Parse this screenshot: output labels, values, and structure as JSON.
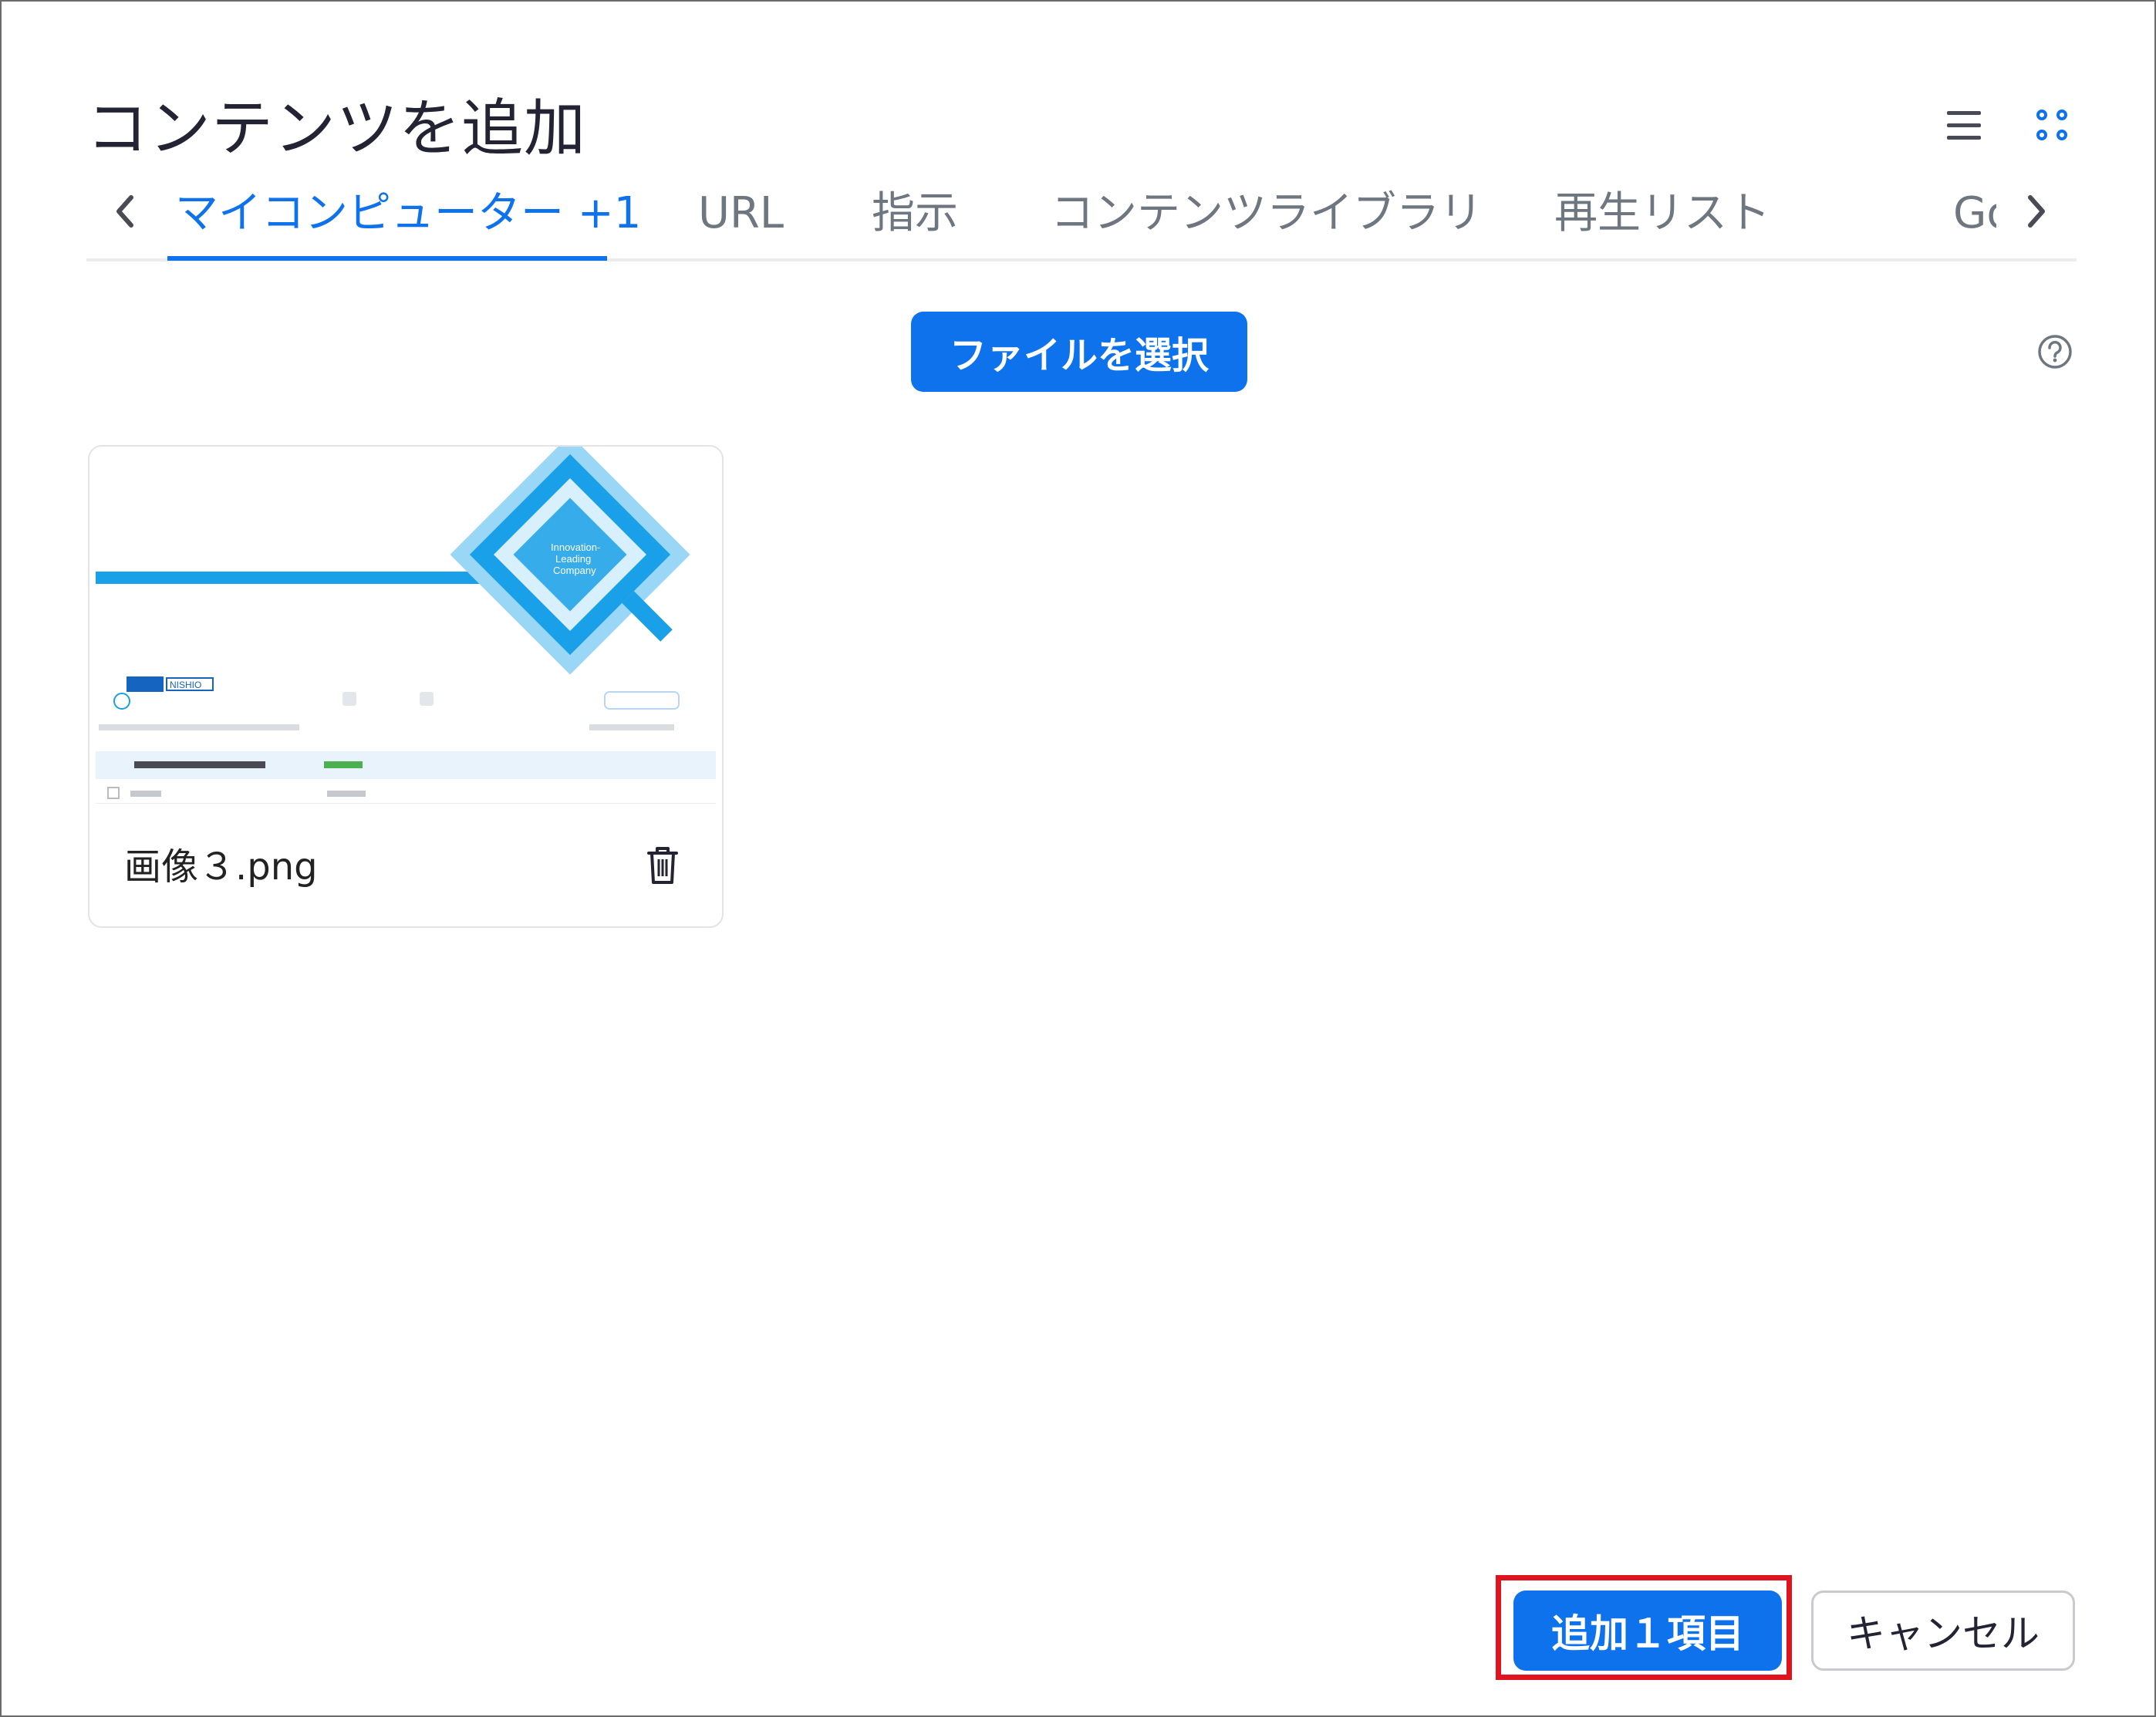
{
  "dialog": {
    "title": "コンテンツを追加",
    "view_toggle": {
      "list_icon": "list-view-icon",
      "grid_icon": "grid-view-icon",
      "active": "grid"
    }
  },
  "tabs": {
    "items": [
      {
        "label": "マイコンピューター +1",
        "active": true
      },
      {
        "label": "URL",
        "active": false
      },
      {
        "label": "指示",
        "active": false
      },
      {
        "label": "コンテンツライブラリ",
        "active": false
      },
      {
        "label": "再生リスト",
        "active": false
      },
      {
        "label": "Go",
        "active": false
      }
    ]
  },
  "upload": {
    "select_label": "ファイルを選択",
    "help_icon": "help-circle-icon"
  },
  "files": [
    {
      "name": "画像３.png",
      "delete_icon": "trash-icon"
    }
  ],
  "thumbnail": {
    "logo_text": "Innovation-\nLeading\nCompany",
    "brand": "NISHIO"
  },
  "footer": {
    "add_label": "追加１項目",
    "cancel_label": "キャンセル"
  },
  "colors": {
    "accent": "#0e72ed",
    "highlight": "#e0141e",
    "tab_inactive": "#6e7680"
  }
}
